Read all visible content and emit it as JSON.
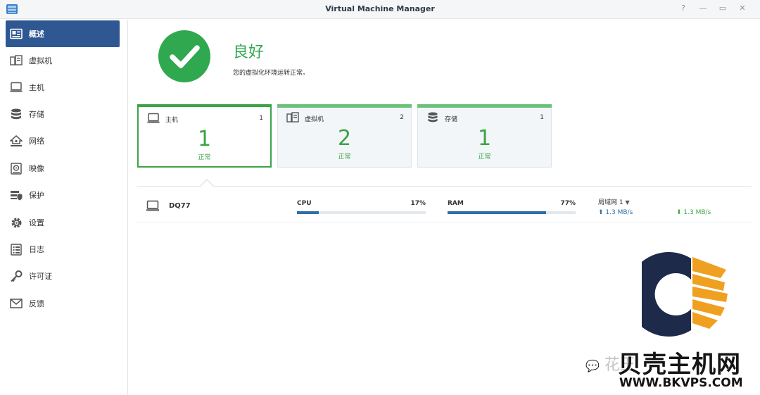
{
  "window": {
    "title": "Virtual Machine Manager",
    "controls": [
      "?",
      "—",
      "▭",
      "✕"
    ]
  },
  "sidebar": {
    "items": [
      {
        "label": "概述",
        "icon": "overview-icon",
        "active": true
      },
      {
        "label": "虚拟机",
        "icon": "vm-icon"
      },
      {
        "label": "主机",
        "icon": "host-icon"
      },
      {
        "label": "存储",
        "icon": "storage-icon"
      },
      {
        "label": "网络",
        "icon": "network-icon"
      },
      {
        "label": "映像",
        "icon": "image-icon"
      },
      {
        "label": "保护",
        "icon": "protection-icon"
      },
      {
        "label": "设置",
        "icon": "gear-icon"
      },
      {
        "label": "日志",
        "icon": "log-icon"
      },
      {
        "label": "许可证",
        "icon": "key-icon"
      },
      {
        "label": "反馈",
        "icon": "feedback-icon"
      }
    ]
  },
  "status": {
    "title": "良好",
    "description": "您的虚拟化环境运转正常。"
  },
  "cards": [
    {
      "name": "主机",
      "count": "1",
      "number": "1",
      "state": "正常",
      "icon": "host-icon"
    },
    {
      "name": "虚拟机",
      "count": "2",
      "number": "2",
      "state": "正常",
      "icon": "vm-icon"
    },
    {
      "name": "存储",
      "count": "1",
      "number": "1",
      "state": "正常",
      "icon": "storage-icon"
    }
  ],
  "host": {
    "name": "DQ77",
    "cpu_label": "CPU",
    "cpu_value": "17%",
    "cpu_fraction": 0.17,
    "ram_label": "RAM",
    "ram_value": "77%",
    "ram_fraction": 0.77,
    "network_label": "局域网 1",
    "upload": "1.3 MB/s",
    "download": "1.3 MB/s"
  },
  "watermark": {
    "text": "花王",
    "brand": "贝壳主机网",
    "url": "WWW.BKVPS.COM"
  },
  "colors": {
    "accent": "#2f5892",
    "ok_green": "#3aa447",
    "bar_blue": "#2f6ea8"
  }
}
